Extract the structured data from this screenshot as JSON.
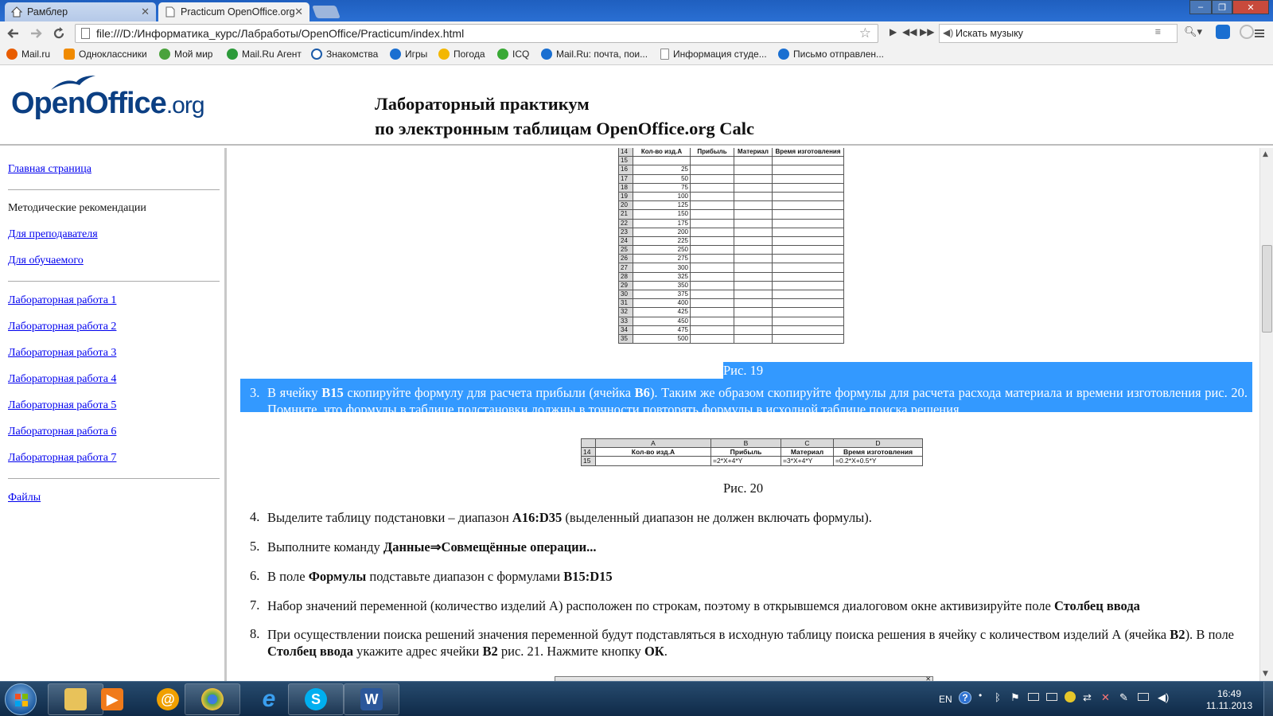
{
  "browser": {
    "tabs": [
      {
        "title": "Рамблер",
        "active": false
      },
      {
        "title": "Practicum OpenOffice.org",
        "active": true
      }
    ],
    "window_controls": {
      "minimize": "–",
      "maximize": "❐",
      "close": "✕"
    },
    "url": "file:///D:/Информатика_курс/Лабработы/OpenOffice/Practicum/index.html",
    "music_search_placeholder": "Искать музыку",
    "bookmarks": [
      {
        "label": "Mail.ru",
        "icon": "mailru-icon",
        "color": "#e85c00"
      },
      {
        "label": "Одноклассники",
        "icon": "odnoklassniki-icon",
        "color": "#f08a00"
      },
      {
        "label": "Мой мир",
        "icon": "moymir-icon",
        "color": "#4aa23c"
      },
      {
        "label": "Mail.Ru Агент",
        "icon": "agent-icon",
        "color": "#2c9a3a"
      },
      {
        "label": "Знакомства",
        "icon": "at-icon",
        "color": "#1a5aa8"
      },
      {
        "label": "Игры",
        "icon": "games-icon",
        "color": "#1a6fd1"
      },
      {
        "label": "Погода",
        "icon": "weather-icon",
        "color": "#f3b700"
      },
      {
        "label": "ICQ",
        "icon": "icq-icon",
        "color": "#39a935"
      },
      {
        "label": "Mail.Ru: почта, пои...",
        "icon": "mailru-icon",
        "color": "#1a6fd1"
      },
      {
        "label": "Информация студе...",
        "icon": "page-icon",
        "color": "#dddddd"
      },
      {
        "label": "Письмо отправлен...",
        "icon": "mailru-icon",
        "color": "#1a6fd1"
      }
    ]
  },
  "header": {
    "logo_main": "OpenOffice",
    "logo_suffix": ".org",
    "title_line1": "Лабораторный практикум",
    "title_line2": "по электронным таблицам OpenOffice.org Calc"
  },
  "nav": {
    "home": "Главная страница",
    "methods_heading": "Методические рекомендации",
    "for_teacher": "Для преподавателя",
    "for_student": "Для обучаемого",
    "labs": [
      "Лабораторная работа 1",
      "Лабораторная работа 2",
      "Лабораторная работа 3",
      "Лабораторная работа 4",
      "Лабораторная работа 5",
      "Лабораторная работа 6",
      "Лабораторная работа 7"
    ],
    "files": "Файлы"
  },
  "figure19": {
    "headers": [
      "Кол-во изд.А",
      "Прибыль",
      "Материал",
      "Время изготовления"
    ],
    "rows": [
      [
        "14",
        "",
        "",
        "",
        ""
      ],
      [
        "15",
        "",
        "",
        "",
        ""
      ],
      [
        "16",
        "25",
        "",
        "",
        ""
      ],
      [
        "17",
        "50",
        "",
        "",
        ""
      ],
      [
        "18",
        "75",
        "",
        "",
        ""
      ],
      [
        "19",
        "100",
        "",
        "",
        ""
      ],
      [
        "20",
        "125",
        "",
        "",
        ""
      ],
      [
        "21",
        "150",
        "",
        "",
        ""
      ],
      [
        "22",
        "175",
        "",
        "",
        ""
      ],
      [
        "23",
        "200",
        "",
        "",
        ""
      ],
      [
        "24",
        "225",
        "",
        "",
        ""
      ],
      [
        "25",
        "250",
        "",
        "",
        ""
      ],
      [
        "26",
        "275",
        "",
        "",
        ""
      ],
      [
        "27",
        "300",
        "",
        "",
        ""
      ],
      [
        "28",
        "325",
        "",
        "",
        ""
      ],
      [
        "29",
        "350",
        "",
        "",
        ""
      ],
      [
        "30",
        "375",
        "",
        "",
        ""
      ],
      [
        "31",
        "400",
        "",
        "",
        ""
      ],
      [
        "32",
        "425",
        "",
        "",
        ""
      ],
      [
        "33",
        "450",
        "",
        "",
        ""
      ],
      [
        "34",
        "475",
        "",
        "",
        ""
      ],
      [
        "35",
        "500",
        "",
        "",
        ""
      ]
    ],
    "caption": "Рис. 19"
  },
  "step3": {
    "num": "3.",
    "t1": "В ячейку ",
    "b1": "В15",
    "t2": " скопируйте формулу для расчета прибыли (ячейка ",
    "b2": "В6",
    "t3": "). Таким же образом скопируйте формулы для расчета расхода материала и времени изготовления рис. 20. Помните, что формулы в таблице подстановки должны в точности повторять формулы в исходной таблице поиска решения."
  },
  "figure20": {
    "columns": [
      "",
      "A",
      "B",
      "C",
      "D"
    ],
    "header_row": [
      "14",
      "Кол-во изд.А",
      "Прибыль",
      "Материал",
      "Время изготовления"
    ],
    "formula_row": [
      "15",
      "",
      "=2*X+4*Y",
      "=3*X+4*Y",
      "=0.2*X+0.5*Y"
    ],
    "caption": "Рис. 20"
  },
  "steps": [
    {
      "num": "4.",
      "t1": "Выделите таблицу подстановки – диапазон ",
      "b1": "A16:D35",
      "t2": " (выделенный диапазон не должен включать формулы)."
    },
    {
      "num": "5.",
      "t1": "Выполните команду ",
      "b1": "Данные⇒Совмещённые операции...",
      "t2": ""
    },
    {
      "num": "6.",
      "t1": "В поле ",
      "b1": "Формулы",
      "t2": " подставьте диапазон с формулами ",
      "b2": "В15:D15"
    },
    {
      "num": "7.",
      "t1": "Набор значений переменной (количество изделий А) расположен по строкам, поэтому в открывшемся диалоговом окне активизируйте поле ",
      "b1": "Столбец ввода"
    }
  ],
  "step8": {
    "num": "8.",
    "t1": "При осуществлении поиска решений значения переменной будут подставляться в исходную таблицу поиска решения в ячейку с количеством изделий А (ячейка ",
    "b1": "В2",
    "t2": "). В поле ",
    "b2": "Столбец ввода",
    "t3": " укажите адрес ячейки ",
    "b3": "В2",
    "t4": " рис. 21. Нажмите кнопку ",
    "b4": "ОК",
    "t5": "."
  },
  "taskbar": {
    "apps": [
      {
        "name": "explorer",
        "icon": "folder-icon",
        "color": "#e8c25a"
      },
      {
        "name": "media-player",
        "icon": "media-player-icon",
        "color": "#f07a1a"
      },
      {
        "name": "mail-agent",
        "icon": "mail-agent-icon",
        "color": "#f0a000"
      },
      {
        "name": "chrome",
        "icon": "chrome-icon",
        "color": "#55a64a"
      },
      {
        "name": "ie",
        "icon": "ie-icon",
        "color": "#1f8fe0"
      },
      {
        "name": "skype",
        "icon": "skype-icon",
        "color": "#00aff0"
      },
      {
        "name": "word",
        "icon": "word-icon",
        "color": "#2b579a"
      }
    ],
    "lang": "EN",
    "time": "16:49",
    "date": "11.11.2013"
  }
}
